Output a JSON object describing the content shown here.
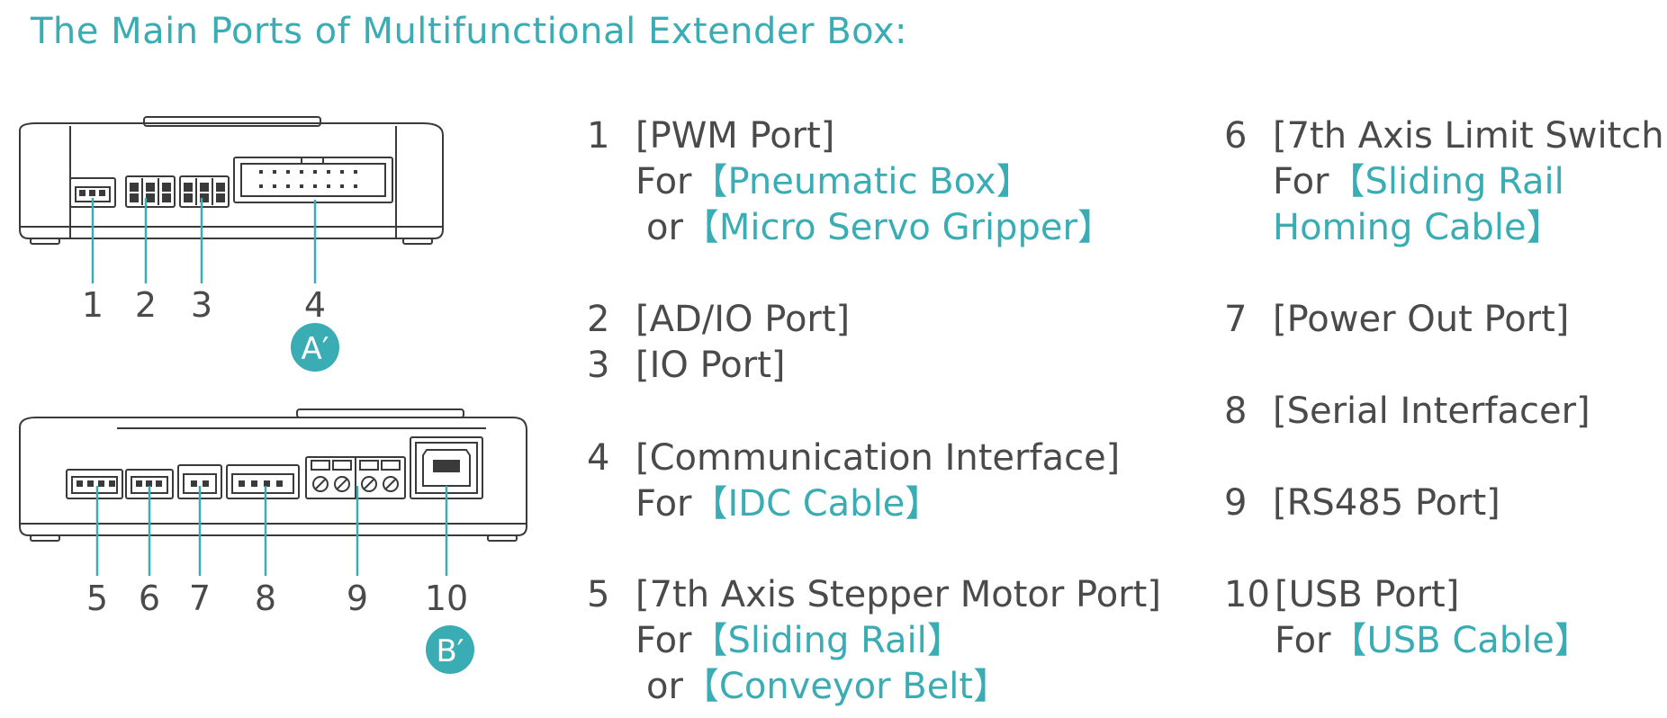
{
  "title": "The Main Ports of Multifunctional Extender Box:",
  "colors": {
    "accent": "#3aacb4",
    "text": "#4a4a4a",
    "device_outline": "#3a3a3a"
  },
  "diagram": {
    "panel_a": {
      "badge": "A′",
      "callouts": [
        "1",
        "2",
        "3",
        "4"
      ]
    },
    "panel_b": {
      "badge": "B′",
      "callouts": [
        "5",
        "6",
        "7",
        "8",
        "9",
        "10"
      ]
    }
  },
  "ports": [
    {
      "num": "1",
      "name": "[PWM Port]",
      "for_word": "For",
      "for": "【Pneumatic Box】",
      "or_word": "or",
      "or": "【Micro Servo Gripper】"
    },
    {
      "num": "2",
      "name": "[AD/IO Port]"
    },
    {
      "num": "3",
      "name": "[IO Port]"
    },
    {
      "num": "4",
      "name": "[Communication Interface]",
      "for_word": "For",
      "for": "【IDC Cable】"
    },
    {
      "num": "5",
      "name": "[7th Axis Stepper Motor Port]",
      "for_word": "For",
      "for": "【Sliding Rail】",
      "or_word": "or",
      "or": "【Conveyor Belt】"
    },
    {
      "num": "6",
      "name": "[7th Axis Limit Switch]",
      "for_word": "For",
      "for": "【Sliding Rail",
      "for_2": "Homing Cable】"
    },
    {
      "num": "7",
      "name": "[Power Out Port]"
    },
    {
      "num": "8",
      "name": "[Serial Interfacer]"
    },
    {
      "num": "9",
      "name": "[RS485 Port]"
    },
    {
      "num": "10",
      "name": "[USB Port]",
      "for_word": "For",
      "for": "【USB Cable】"
    }
  ]
}
